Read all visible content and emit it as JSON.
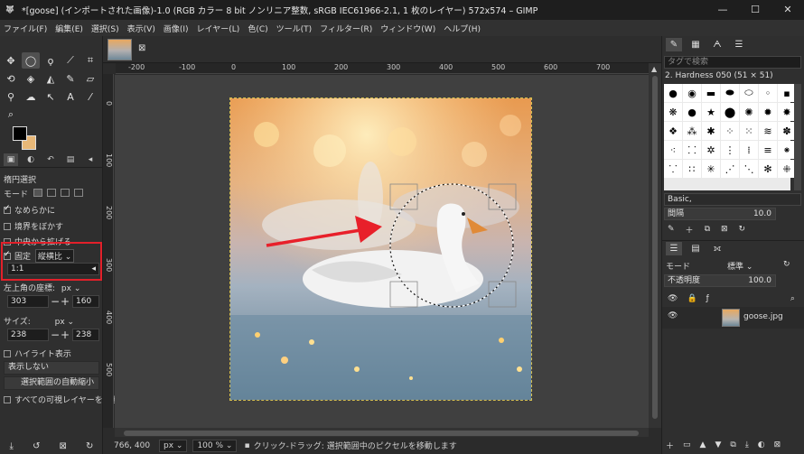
{
  "window": {
    "title": "*[goose] (インポートされた画像)-1.0 (RGB カラー 8 bit ノンリニア整数, sRGB IEC61966-2.1, 1 枚のレイヤー) 572x574 – GIMP",
    "minimize": "—",
    "maximize": "☐",
    "close": "✕"
  },
  "menu": [
    "ファイル(F)",
    "編集(E)",
    "選択(S)",
    "表示(V)",
    "画像(I)",
    "レイヤー(L)",
    "色(C)",
    "ツール(T)",
    "フィルター(R)",
    "ウィンドウ(W)",
    "ヘルプ(H)"
  ],
  "tool_options": {
    "title": "楕円選択",
    "mode_label": "モード",
    "antialias": "なめらかに",
    "feather": "境界をぼかす",
    "expand_center": "中央から拡げる",
    "fixed_label": "固定",
    "fixed_select": "縦横比",
    "ratio_value": "1:1",
    "position_label": "左上角の座標:",
    "position_unit": "px",
    "pos_x": "303",
    "pos_y": "160",
    "size_label": "サイズ:",
    "size_unit": "px",
    "size_w": "238",
    "size_h": "238",
    "highlight": "ハイライト表示",
    "guides": "表示しない",
    "auto_shrink": "選択範囲の自動縮小",
    "all_layers": "すべての可視レイヤーを対象"
  },
  "rulers": {
    "h_ticks": [
      "-200",
      "-100",
      "0",
      "100",
      "200",
      "300",
      "400",
      "500",
      "600",
      "700"
    ],
    "v_ticks": [
      "0",
      "100",
      "200",
      "300",
      "400",
      "500"
    ]
  },
  "status": {
    "coords": "766, 400",
    "unit": "px",
    "zoom": "100 %",
    "message": "クリック-ドラッグ: 選択範囲中のピクセルを移動します"
  },
  "brushes": {
    "filter_placeholder": "タグで検索",
    "selected_brush": "2. Hardness 050 (51 × 51)",
    "preset": "Basic,",
    "spacing_label": "間隔",
    "spacing_value": "10.0"
  },
  "layers": {
    "mode_label": "モード",
    "mode_value": "標準",
    "opacity_label": "不透明度",
    "opacity_value": "100.0",
    "lock_label": "保護:",
    "layer_name": "goose.jpg"
  },
  "colors": {
    "fg": "#000000",
    "bg": "#e8b878",
    "highlight_box": "#e2202a",
    "arrow": "#e8202a"
  }
}
